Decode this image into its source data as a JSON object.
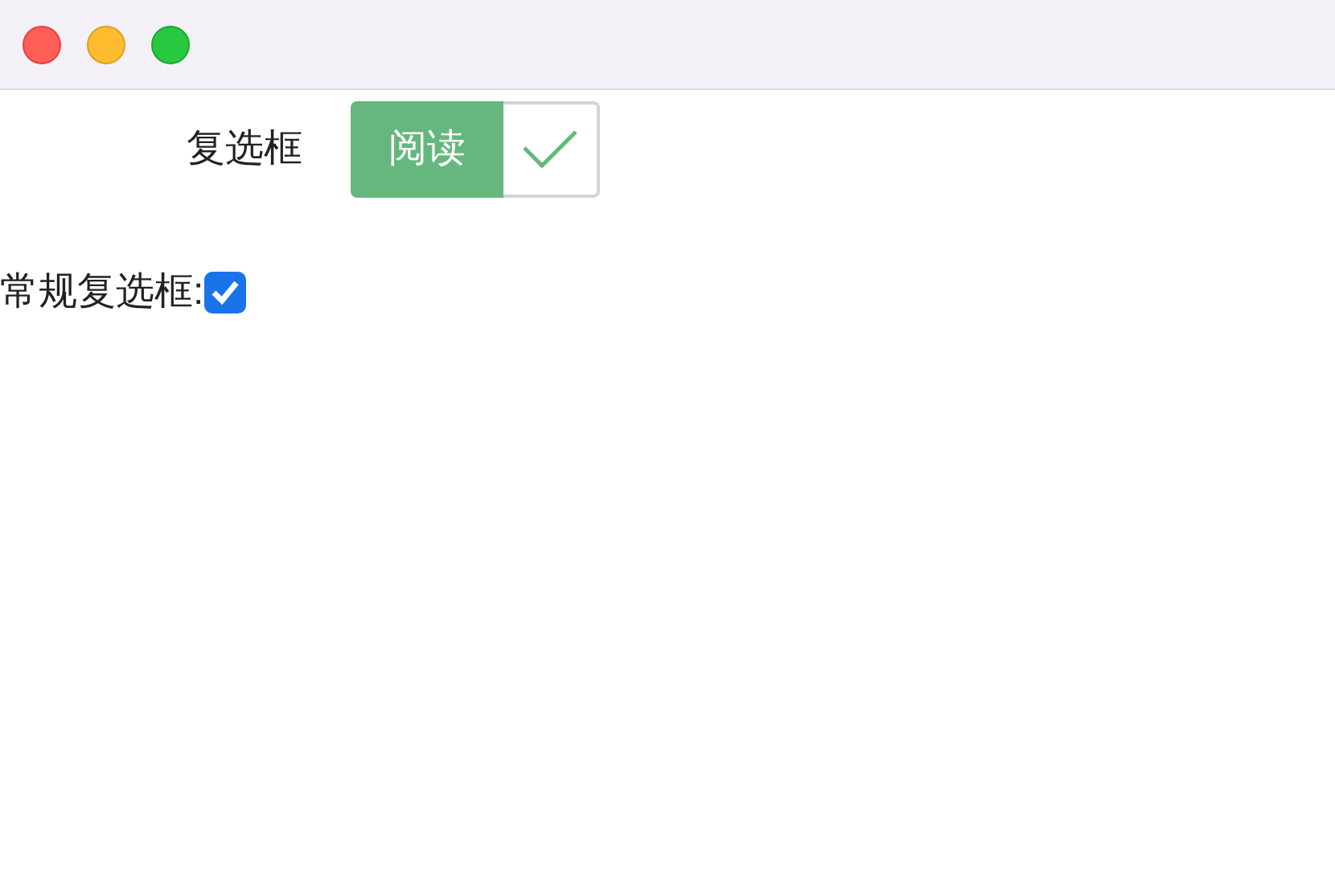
{
  "button_checkbox": {
    "label": "复选框",
    "button_label": "阅读",
    "checked": true
  },
  "plain_checkbox": {
    "label": "常规复选框:",
    "checked": true
  }
}
